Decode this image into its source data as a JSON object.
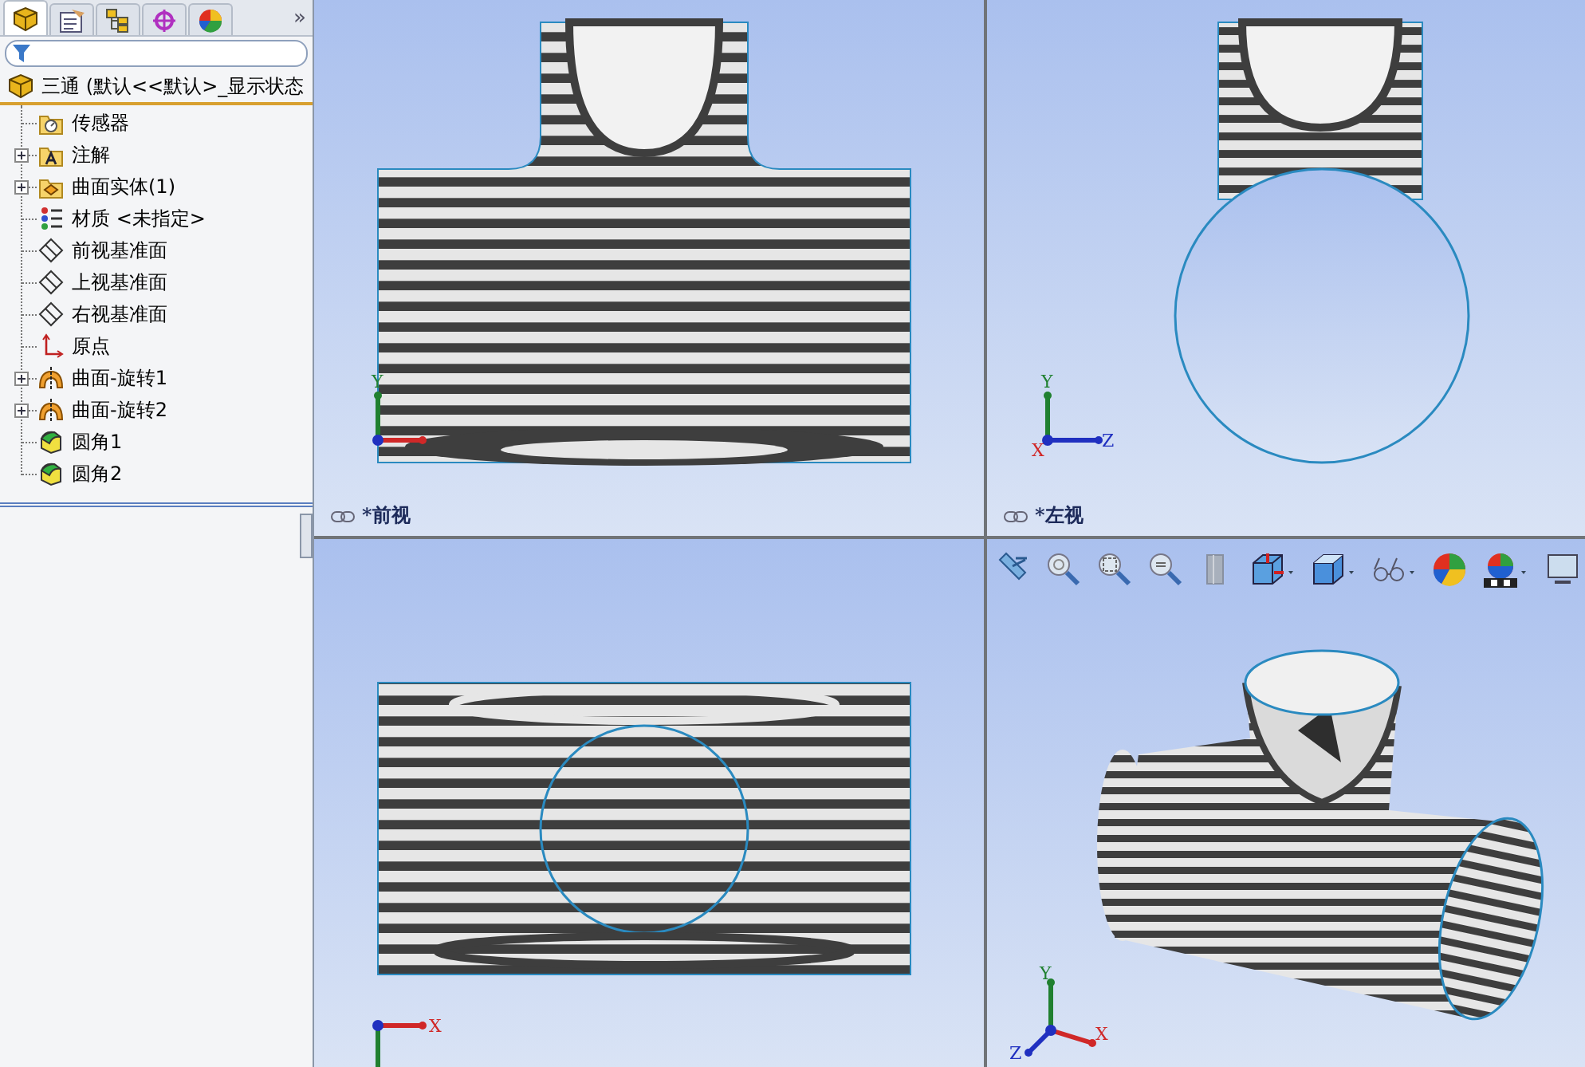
{
  "panel_tabs": [
    {
      "kind": "feature-tree",
      "selected": true
    },
    {
      "kind": "property",
      "selected": false
    },
    {
      "kind": "configuration",
      "selected": false
    },
    {
      "kind": "dimxpert",
      "selected": false
    },
    {
      "kind": "display",
      "selected": false
    }
  ],
  "panel_overflow": "»",
  "tree": {
    "root": {
      "label": "三通  (默认<<默认>_显示状态"
    },
    "items": [
      {
        "kind": "sensor",
        "label": "传感器",
        "expandable": false
      },
      {
        "kind": "annotation",
        "label": "注解",
        "expandable": true
      },
      {
        "kind": "solid-bodies",
        "label": "曲面实体(1)",
        "expandable": true
      },
      {
        "kind": "material",
        "label": "材质 <未指定>",
        "expandable": false
      },
      {
        "kind": "plane",
        "label": "前视基准面",
        "expandable": false
      },
      {
        "kind": "plane",
        "label": "上视基准面",
        "expandable": false
      },
      {
        "kind": "plane",
        "label": "右视基准面",
        "expandable": false
      },
      {
        "kind": "origin",
        "label": "原点",
        "expandable": false
      },
      {
        "kind": "revolve",
        "label": "曲面-旋转1",
        "expandable": true
      },
      {
        "kind": "revolve",
        "label": "曲面-旋转2",
        "expandable": true
      },
      {
        "kind": "fillet",
        "label": "圆角1",
        "expandable": false
      },
      {
        "kind": "fillet",
        "label": "圆角2",
        "expandable": false
      }
    ]
  },
  "viewports": [
    {
      "kind": "front",
      "label": "*前视",
      "axes": [
        {
          "kind": "y",
          "label": "Y"
        }
      ]
    },
    {
      "kind": "left",
      "label": "*左视",
      "axes": [
        {
          "kind": "y",
          "label": "Y"
        },
        {
          "kind": "x",
          "label": "X"
        },
        {
          "kind": "z",
          "label": "Z"
        }
      ]
    },
    {
      "kind": "top",
      "axes": [
        {
          "kind": "x",
          "label": "X"
        }
      ]
    },
    {
      "kind": "iso",
      "axes": [
        {
          "kind": "y",
          "label": "Y"
        },
        {
          "kind": "x",
          "label": "X"
        },
        {
          "kind": "z",
          "label": "Z"
        }
      ]
    }
  ],
  "view_toolbar": [
    {
      "kind": "previous-view",
      "dropdown": false
    },
    {
      "kind": "zoom-fit",
      "dropdown": false
    },
    {
      "kind": "zoom-area",
      "dropdown": false
    },
    {
      "kind": "zoom",
      "dropdown": false
    },
    {
      "kind": "section",
      "dropdown": false
    },
    {
      "kind": "orientation",
      "dropdown": true
    },
    {
      "kind": "display-style",
      "dropdown": true
    },
    {
      "kind": "hide-show",
      "dropdown": true
    },
    {
      "kind": "appearance",
      "dropdown": false
    },
    {
      "kind": "scene",
      "dropdown": true
    },
    {
      "kind": "monitor",
      "dropdown": false
    }
  ]
}
